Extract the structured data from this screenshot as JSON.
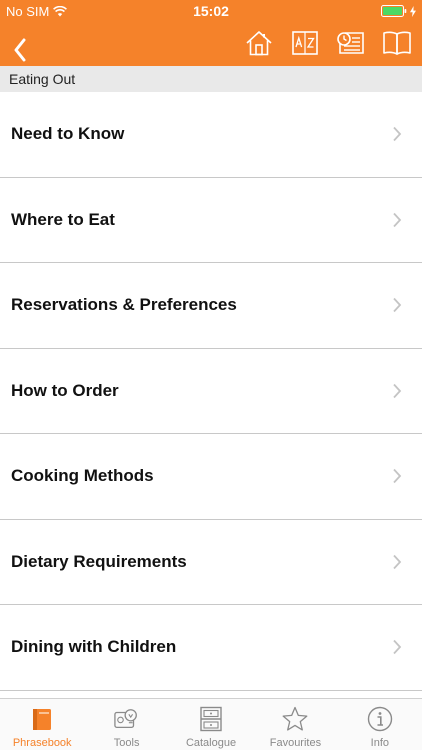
{
  "status_bar": {
    "carrier": "No SIM",
    "time": "15:02"
  },
  "nav": {
    "back_icon": "chevron-left-icon",
    "icons": [
      "home-icon",
      "dictionary-icon",
      "history-icon",
      "book-icon"
    ]
  },
  "section": {
    "title": "Eating Out"
  },
  "list": {
    "items": [
      {
        "label": "Need to Know"
      },
      {
        "label": "Where to Eat"
      },
      {
        "label": "Reservations & Preferences"
      },
      {
        "label": "How to Order"
      },
      {
        "label": "Cooking Methods"
      },
      {
        "label": "Dietary Requirements"
      },
      {
        "label": "Dining with Children"
      }
    ]
  },
  "tab_bar": {
    "tabs": [
      {
        "label": "Phrasebook",
        "icon": "phrasebook-icon",
        "active": true
      },
      {
        "label": "Tools",
        "icon": "tools-icon",
        "active": false
      },
      {
        "label": "Catalogue",
        "icon": "catalogue-icon",
        "active": false
      },
      {
        "label": "Favourites",
        "icon": "star-icon",
        "active": false
      },
      {
        "label": "Info",
        "icon": "info-icon",
        "active": false
      }
    ]
  },
  "colors": {
    "accent": "#f5822a",
    "battery": "#4cd964",
    "section_bg": "#e9e9e9",
    "inactive": "#8a8a8a"
  }
}
